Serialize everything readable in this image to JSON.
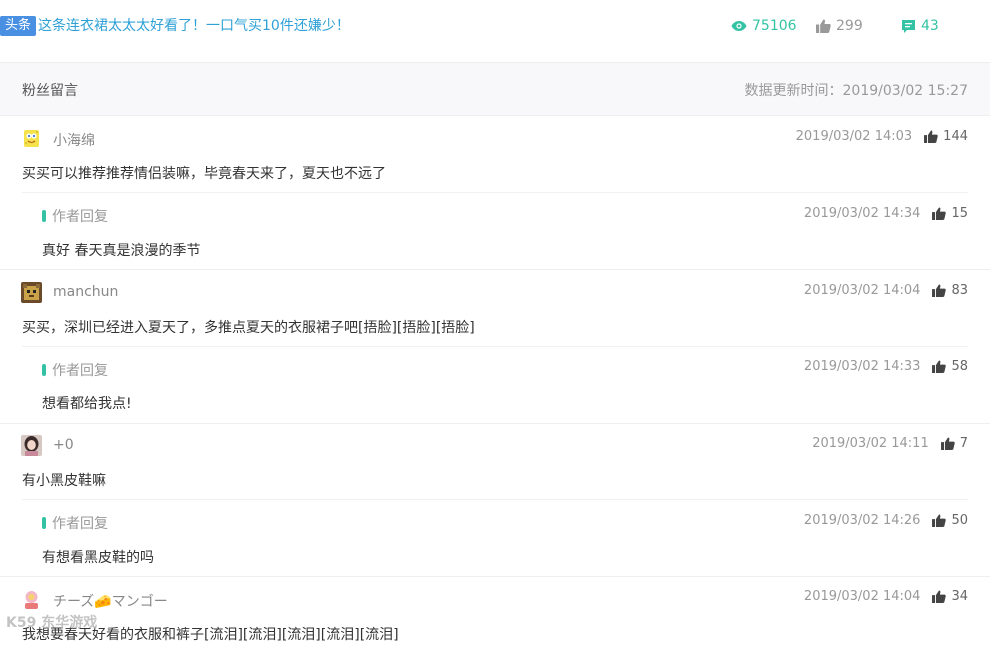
{
  "article": {
    "tag": "头条",
    "title": "这条连衣裙太太太好看了！一口气买10件还嫌少！",
    "views": "75106",
    "likes": "299",
    "comments": "43"
  },
  "section": {
    "title": "粉丝留言",
    "update_time": "数据更新时间：2019/03/02 15:27"
  },
  "reply_label": "作者回复",
  "comments": [
    {
      "user": "小海绵",
      "time": "2019/03/02 14:03",
      "likes": "144",
      "text": "买买可以推荐推荐情侣装嘛，毕竟春天来了，夏天也不远了",
      "reply": {
        "time": "2019/03/02 14:34",
        "likes": "15",
        "text": "真好 春天真是浪漫的季节"
      }
    },
    {
      "user": "manchun",
      "time": "2019/03/02 14:04",
      "likes": "83",
      "text": "买买，深圳已经进入夏天了，多推点夏天的衣服裙子吧[捂脸][捂脸][捂脸]",
      "reply": {
        "time": "2019/03/02 14:33",
        "likes": "58",
        "text": "想看都给我点!"
      }
    },
    {
      "user": "+0",
      "time": "2019/03/02 14:11",
      "likes": "7",
      "text": "有小黑皮鞋嘛",
      "reply": {
        "time": "2019/03/02 14:26",
        "likes": "50",
        "text": "有想看黑皮鞋的吗"
      }
    },
    {
      "user": "チーズ🧀マンゴー",
      "time": "2019/03/02 14:04",
      "likes": "34",
      "text": "我想要春天好看的衣服和裤子[流泪][流泪][流泪][流泪][流泪]"
    }
  ],
  "watermark": "K59 东华游戏",
  "colors": {
    "accent": "#33c3a4",
    "tag": "#4a90e2",
    "title": "#2fa1d6"
  }
}
